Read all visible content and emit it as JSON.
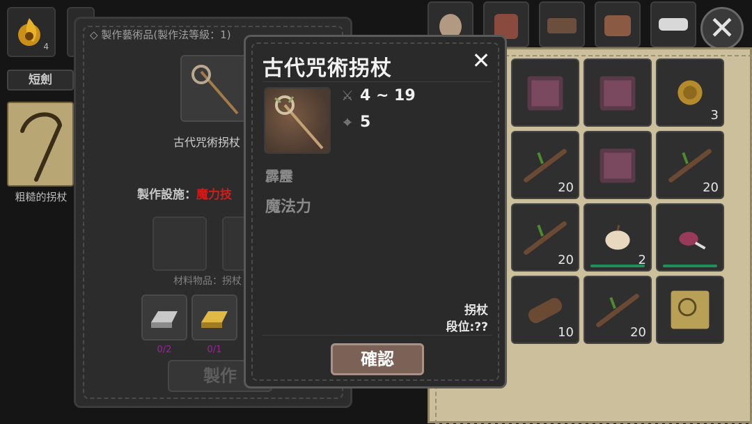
{
  "hud": {
    "slot1_count": "4"
  },
  "left_panel": {
    "tab_short_sword": "短劍",
    "item_label": "粗糙的拐杖"
  },
  "craft_panel": {
    "title": "製作藝術品(製作法等級：1)",
    "item_name": "古代咒術拐杖",
    "facility_label": "製作設施：",
    "facility_value": "魔力技",
    "materials_label": "材料物品：拐杖",
    "ingredients": [
      {
        "name": "silver-ingot",
        "count": "0/2"
      },
      {
        "name": "gold-ingot",
        "count": "0/1"
      }
    ],
    "craft_button": "製作"
  },
  "inventory": {
    "cells": [
      {
        "icon": "spellbook-icon",
        "count": ""
      },
      {
        "icon": "spellbook-icon",
        "count": ""
      },
      {
        "icon": "coin-icon",
        "count": "3"
      },
      {
        "icon": "branch-icon",
        "count": "20"
      },
      {
        "icon": "spellbook-icon",
        "count": ""
      },
      {
        "icon": "branch-icon",
        "count": "20"
      },
      {
        "icon": "branch-icon",
        "count": "20"
      },
      {
        "icon": "pumpkin-icon",
        "count": "2"
      },
      {
        "icon": "meat-icon",
        "count": ""
      },
      {
        "icon": "log-icon",
        "count": "10"
      },
      {
        "icon": "branch-icon",
        "count": "20"
      },
      {
        "icon": "map-scroll-icon",
        "count": ""
      }
    ]
  },
  "modal": {
    "title": "古代咒術拐杖",
    "damage": "4 ~ 19",
    "accuracy": "5",
    "element": "霹靂",
    "attribute": "魔法力",
    "item_type": "拐杖",
    "rank": "段位:??",
    "confirm_button": "確認"
  }
}
